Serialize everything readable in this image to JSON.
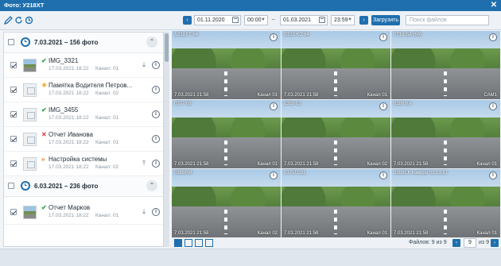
{
  "window": {
    "title": "Фото: У218ХТ",
    "close_label": "✕"
  },
  "toolbar": {
    "date_from": "01.11.2020",
    "time_from": "00:00",
    "date_to": "01.03.2021",
    "time_to": "23:59",
    "dash": "–",
    "load_label": "Загрузить",
    "search_placeholder": "Поиск файлов",
    "prev": "‹",
    "next": "›"
  },
  "groups": [
    {
      "title": "7.03.2021 – 156 фото",
      "items": [
        {
          "status": "✔",
          "title": "IMG_3321",
          "date": "17.03.2021 18:22",
          "channel": "Канал: 01",
          "thumb": "photo"
        },
        {
          "status": "☀",
          "title": "Памятка Водителя Петров...",
          "date": "17.03.2021 18:22",
          "channel": "Канал: 02",
          "thumb": "doc"
        },
        {
          "status": "✔",
          "title": "IMG_3455",
          "date": "17.03.2021 18:22",
          "channel": "Канал: 01",
          "thumb": "doc"
        },
        {
          "status": "✕",
          "title": "Отчет Иванова",
          "date": "17.03.2021 18:22",
          "channel": "Канал: 01",
          "thumb": "doc"
        },
        {
          "status": "»",
          "title": "Настройка системы",
          "date": "17.03.2021 18:22",
          "channel": "Канал: 02",
          "thumb": "doc"
        }
      ]
    },
    {
      "title": "6.03.2021 – 236 фото",
      "items": [
        {
          "status": "✔",
          "title": "Отчет Марков",
          "date": "17.03.2021 18:22",
          "channel": "Канал: 01",
          "thumb": "photo"
        }
      ]
    }
  ],
  "tiles": [
    {
      "caption": "А218ХТ 64",
      "date": "7.03.2021 21:58",
      "channel": "Канал 01"
    },
    {
      "caption": "В315 КС 64",
      "date": "7.03.2021 21:58",
      "channel": "Канал 01"
    },
    {
      "caption": "0718 ВА (64)",
      "date": "",
      "channel": "CAM1"
    },
    {
      "caption": "0377 08",
      "date": "7.03.2021 21:58",
      "channel": "Канал 01"
    },
    {
      "caption": "0355 03",
      "date": "7.03.2021 21:58",
      "channel": "Канал 02"
    },
    {
      "caption": "0388 КА",
      "date": "7.03.2021 21:58",
      "channel": "Канал 01"
    },
    {
      "caption": "0368RM",
      "date": "7.03.2021 21:58",
      "channel": "Канал 02"
    },
    {
      "caption": "0375ГС01",
      "date": "7.03.2021 21:58",
      "channel": "Канал 01"
    },
    {
      "caption": "0388СК камера 01.03.17",
      "date": "7.03.2021 21:58",
      "channel": "Канал 01"
    }
  ],
  "footer": {
    "files_label": "Файлов: 9 из 9",
    "page": "9",
    "of_label": "из 9",
    "prev": "‹",
    "next": "›"
  },
  "icons": {
    "edit": "pencil-icon",
    "refresh": "refresh-icon",
    "history": "history-icon"
  },
  "colors": {
    "accent": "#1f6fae",
    "ok": "#2e9e4a",
    "warn": "#f0a31b",
    "error": "#d8342b"
  }
}
